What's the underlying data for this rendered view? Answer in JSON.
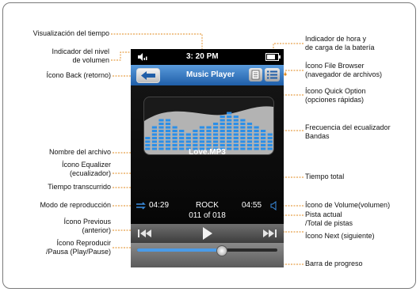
{
  "labels": {
    "time_display": "Visualización del tiempo",
    "volume_level": [
      "Indicador del nivel",
      "de volumen"
    ],
    "back_icon": "Ícono Back (retorno)",
    "file_name": "Nombre del archivo",
    "equalizer_icon": [
      "Ícono Equalizer",
      "(ecualizador)"
    ],
    "elapsed_time": "Tiempo transcurrido",
    "play_mode": "Modo de reproducción",
    "previous_icon": [
      "Ícono Previous",
      "(anterior)"
    ],
    "play_pause_icon": [
      "Ícono Reproducir",
      "/Pausa (Play/Pause)"
    ],
    "clock_battery": [
      "Indicador de hora y",
      "de carga de la batería"
    ],
    "file_browser_icon": [
      "Ícono File Browser",
      "(navegador de archivos)"
    ],
    "quick_option_icon": [
      "Ícono Quick Option",
      "(opciones rápidas)"
    ],
    "eq_frequency": [
      "Frecuencia del ecualizador",
      "Bandas"
    ],
    "total_time": "Tiempo total",
    "volume_icon": "Ícono de Volume(volumen)",
    "current_track": [
      "Pista actual",
      "/Total de pistas"
    ],
    "next_icon": "Ícono Next (siguiente)",
    "progress_bar": "Barra de progreso"
  },
  "device": {
    "clock": "3: 20 PM",
    "title": "Music Player",
    "file_name": "Love.MP3",
    "elapsed": "04:29",
    "total": "04:55",
    "eq_preset": "ROCK",
    "track": "011 of 018",
    "progress": 0.6,
    "eq_bands": [
      0.35,
      0.55,
      0.72,
      0.78,
      0.62,
      0.48,
      0.42,
      0.5,
      0.55,
      0.62,
      0.7,
      0.8,
      0.92,
      0.85,
      0.78,
      0.7,
      0.62,
      0.5,
      0.4
    ]
  },
  "colors": {
    "accent_blue": "#2f7fd6",
    "eq_blue": "#2b8fe8",
    "leader_orange": "#e08a1e"
  }
}
